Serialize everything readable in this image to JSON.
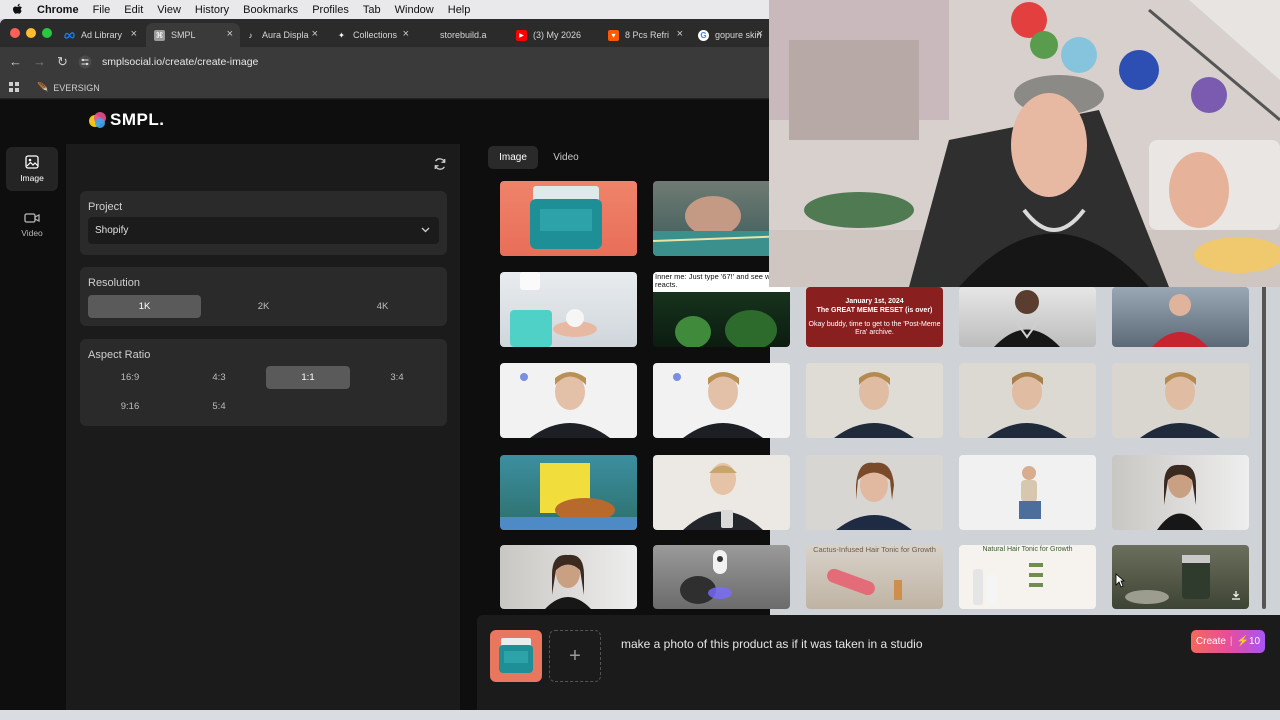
{
  "menubar": {
    "app": "Chrome",
    "items": [
      "File",
      "Edit",
      "View",
      "History",
      "Bookmarks",
      "Profiles",
      "Tab",
      "Window",
      "Help"
    ]
  },
  "browser": {
    "tabs": [
      {
        "label": "Ad Library",
        "icon": "meta-icon",
        "color": "#1877f2"
      },
      {
        "label": "SMPL",
        "icon": "smpl-favicon",
        "color": "#9b9b9b"
      },
      {
        "label": "Aura Displa",
        "icon": "tiktok-icon",
        "color": "#111111"
      },
      {
        "label": "Collections",
        "icon": "capcut-icon",
        "color": "#111111"
      },
      {
        "label": "storebuild.a",
        "icon": "storebuild-icon",
        "color": "#2b2b2b"
      },
      {
        "label": "(3) My 2026",
        "icon": "youtube-icon",
        "color": "#ff0000"
      },
      {
        "label": "8 Pcs Refri",
        "icon": "temu-icon",
        "color": "#fb7701"
      },
      {
        "label": "gopure skin",
        "icon": "google-icon",
        "color": "#4285f4"
      }
    ],
    "url": "smplsocial.io/create/create-image",
    "bookmark": "EVERSIGN"
  },
  "app": {
    "logo": "SMPL.",
    "nav": [
      {
        "label": "Image",
        "icon": "image-icon"
      },
      {
        "label": "Video",
        "icon": "video-icon"
      }
    ],
    "project": {
      "title": "Project",
      "value": "Shopify"
    },
    "resolution": {
      "title": "Resolution",
      "options": [
        "1K",
        "2K",
        "4K"
      ],
      "selected": "1K"
    },
    "aspect_ratio": {
      "title": "Aspect Ratio",
      "options": [
        "16:9",
        "4:3",
        "1:1",
        "3:4",
        "9:16",
        "5:4"
      ],
      "selected": "1:1"
    },
    "media_tabs": [
      "Image",
      "Video"
    ],
    "gallery_captions": {
      "meme_tweet": "Inner me: Just type '67!' and see who reacts.",
      "meme_reset_date": "January 1st, 2024",
      "meme_reset_title": "The GREAT MEME RESET (is over)",
      "meme_reset_sub": "Okay buddy, time to get to the 'Post-Meme Era' archive.",
      "hair_tonic_1": "Cactus-Infused Hair Tonic for Growth",
      "hair_tonic_2": "Natural Hair Tonic for Growth"
    },
    "prompt": "make a photo of this product as if it was taken in a studio",
    "create_label": "Create",
    "create_cost": "10",
    "create_sep": "|"
  },
  "colors": {
    "accent_gradient_start": "#f26a5a",
    "accent_gradient_end": "#a855f7",
    "panel": "#1b1b1b",
    "card": "#2a2a2a"
  }
}
